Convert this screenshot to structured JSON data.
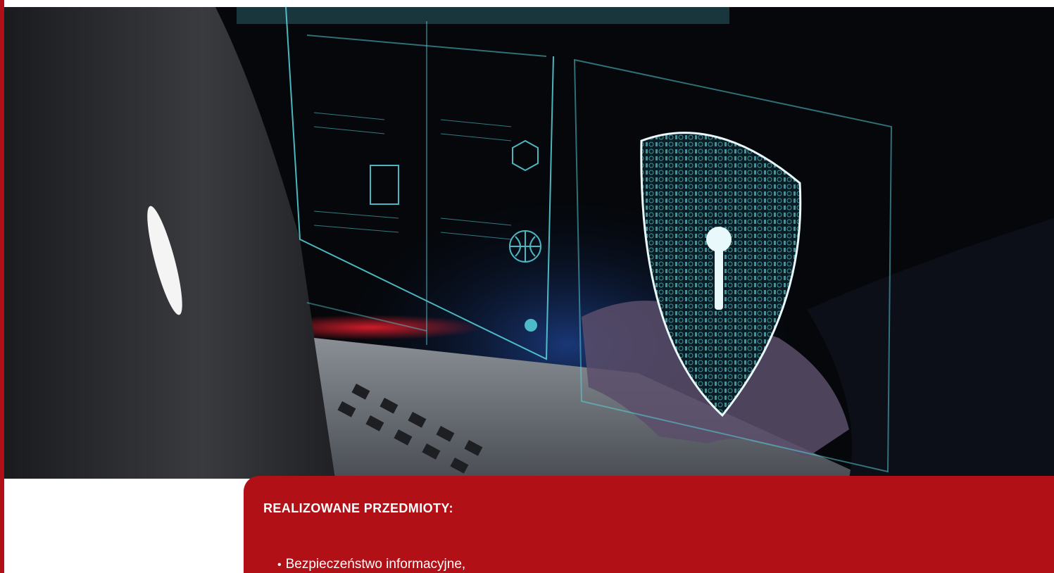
{
  "hero": {
    "icon": "shield-lock-icon",
    "secondary_icons": [
      "globe-icon",
      "hexagon-icon",
      "chart-icon"
    ]
  },
  "card": {
    "title": "REALIZOWANE PRZEDMIOTY:",
    "subjects": [
      "Bezpieczeństwo informacyjne,"
    ]
  },
  "colors": {
    "accent_red": "#b01016",
    "hologram_cyan": "#5ad6e0",
    "background_dark": "#05070a"
  }
}
